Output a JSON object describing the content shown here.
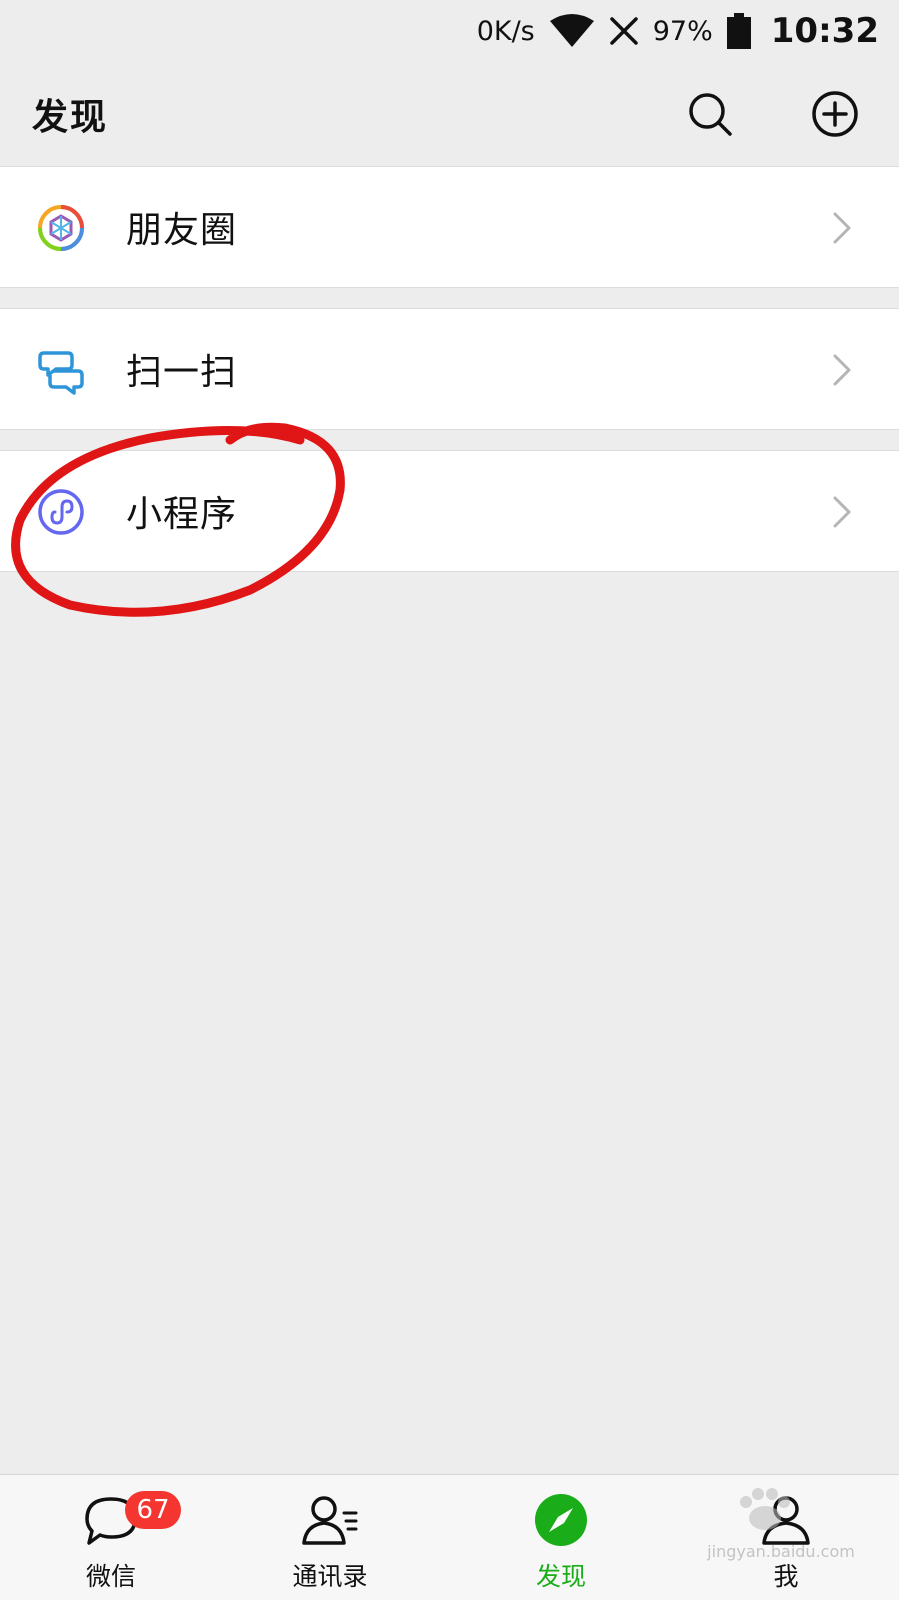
{
  "status_bar": {
    "net_speed": "0K/s",
    "battery": "97%",
    "time": "10:32"
  },
  "header": {
    "title": "发现"
  },
  "menu": [
    {
      "label": "朋友圈",
      "icon": "moments-icon"
    },
    {
      "label": "扫一扫",
      "icon": "scan-icon"
    },
    {
      "label": "小程序",
      "icon": "mini-program-icon"
    }
  ],
  "tabs": [
    {
      "label": "微信",
      "badge": "67",
      "icon": "chat-bubble-icon"
    },
    {
      "label": "通讯录",
      "icon": "contacts-icon"
    },
    {
      "label": "发现",
      "icon": "compass-icon",
      "active": true
    },
    {
      "label": "我",
      "icon": "person-icon"
    }
  ],
  "watermark": {
    "text": "jingyan.baidu.com"
  },
  "colors": {
    "accent": "#1aad19",
    "badge": "#f43530",
    "background": "#ededed",
    "annotation": "#e01515"
  }
}
